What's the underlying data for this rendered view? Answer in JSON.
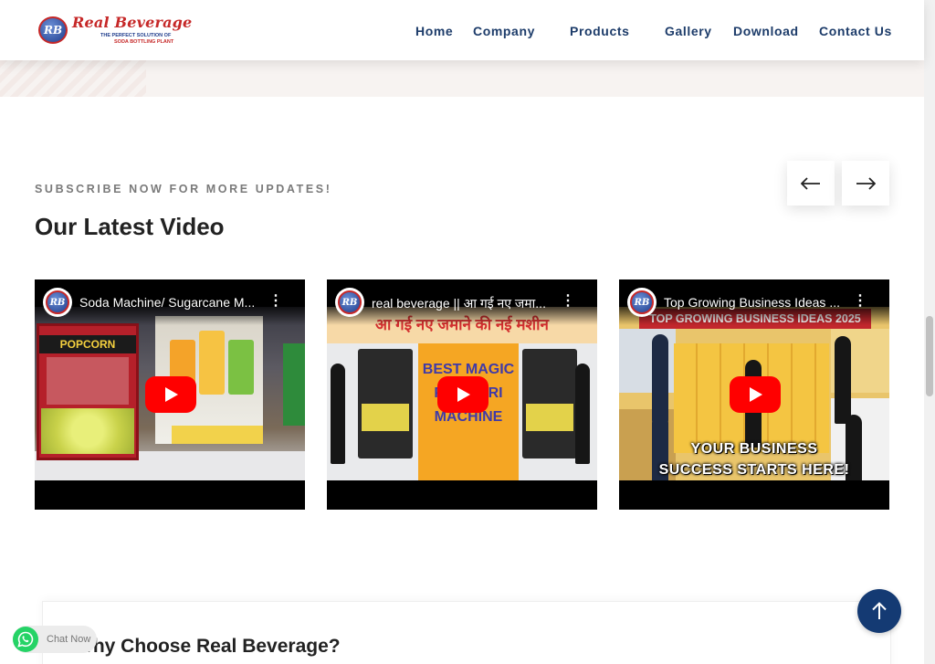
{
  "brand": {
    "name": "Real Beverage",
    "badge": "RB",
    "tagline_1": "THE PERFECT SOLUTION OF",
    "tagline_2": "SODA BOTTLING PLANT"
  },
  "nav": [
    {
      "label": "Home"
    },
    {
      "label": "Company"
    },
    {
      "label": "Products"
    },
    {
      "label": "Gallery"
    },
    {
      "label": "Download"
    },
    {
      "label": "Contact Us"
    }
  ],
  "section": {
    "eyebrow": "SUBSCRIBE NOW FOR MORE UPDATES!",
    "title": "Our Latest Video"
  },
  "videos": [
    {
      "title": "Soda Machine/ Sugarcane M...",
      "thumb_text": "POPCORN"
    },
    {
      "title": "real beverage || आ गई नए जमा...",
      "banner": "आ गई नए जमाने की नई मशीन",
      "center_text": "BEST MAGIC PANIPURI MACHINE"
    },
    {
      "title": "Top Growing Business Ideas ...",
      "banner": "TOP GROWING BUSINESS IDEAS 2025",
      "line1": "YOUR BUSINESS",
      "line2": "SUCCESS STARTS HERE!"
    }
  ],
  "why": {
    "title": "Why Choose Real Beverage?"
  },
  "chat": {
    "label": "Chat Now"
  },
  "colors": {
    "nav_text": "#1d3c6a",
    "brand_red": "#c62828",
    "brand_blue": "#1e3c8c",
    "scroll_top_bg": "#143a73",
    "whatsapp": "#25d366",
    "youtube_red": "#ff0000"
  },
  "icons": {
    "prev": "arrow-left-icon",
    "next": "arrow-right-icon",
    "play": "youtube-play-icon",
    "menu": "more-vert-icon",
    "chat": "whatsapp-icon",
    "to_top": "arrow-up-icon"
  }
}
